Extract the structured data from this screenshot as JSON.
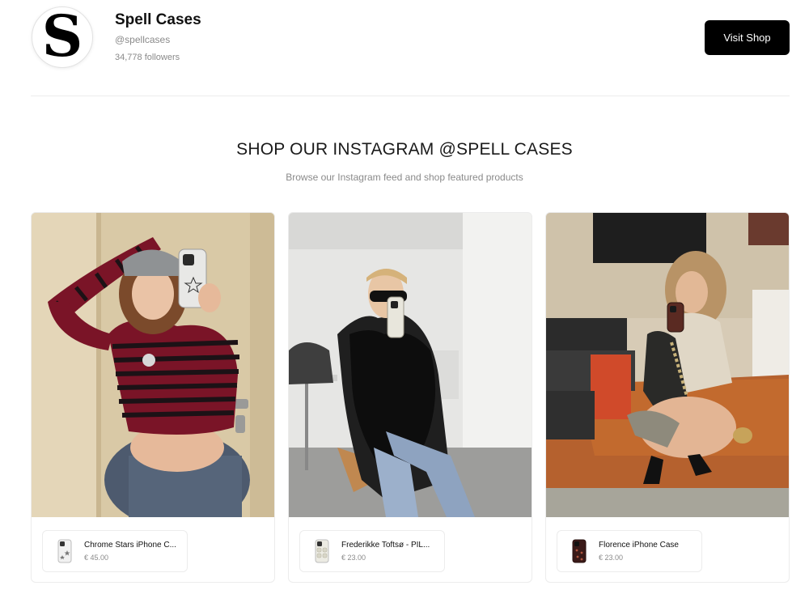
{
  "shop": {
    "name": "Spell Cases",
    "handle": "@spellcases",
    "followers": "34,778 followers",
    "avatar_letter": "S",
    "visit_label": "Visit Shop"
  },
  "section": {
    "title": "SHOP OUR INSTAGRAM @SPELL CASES",
    "subtitle": "Browse our Instagram feed and shop featured products"
  },
  "posts": [
    {
      "product": {
        "name": "Chrome Stars iPhone C...",
        "price": "€ 45.00"
      }
    },
    {
      "product": {
        "name": "Frederikke Toftsø - PIL...",
        "price": "€ 23.00"
      }
    },
    {
      "product": {
        "name": "Florence iPhone Case",
        "price": "€ 23.00"
      }
    }
  ]
}
